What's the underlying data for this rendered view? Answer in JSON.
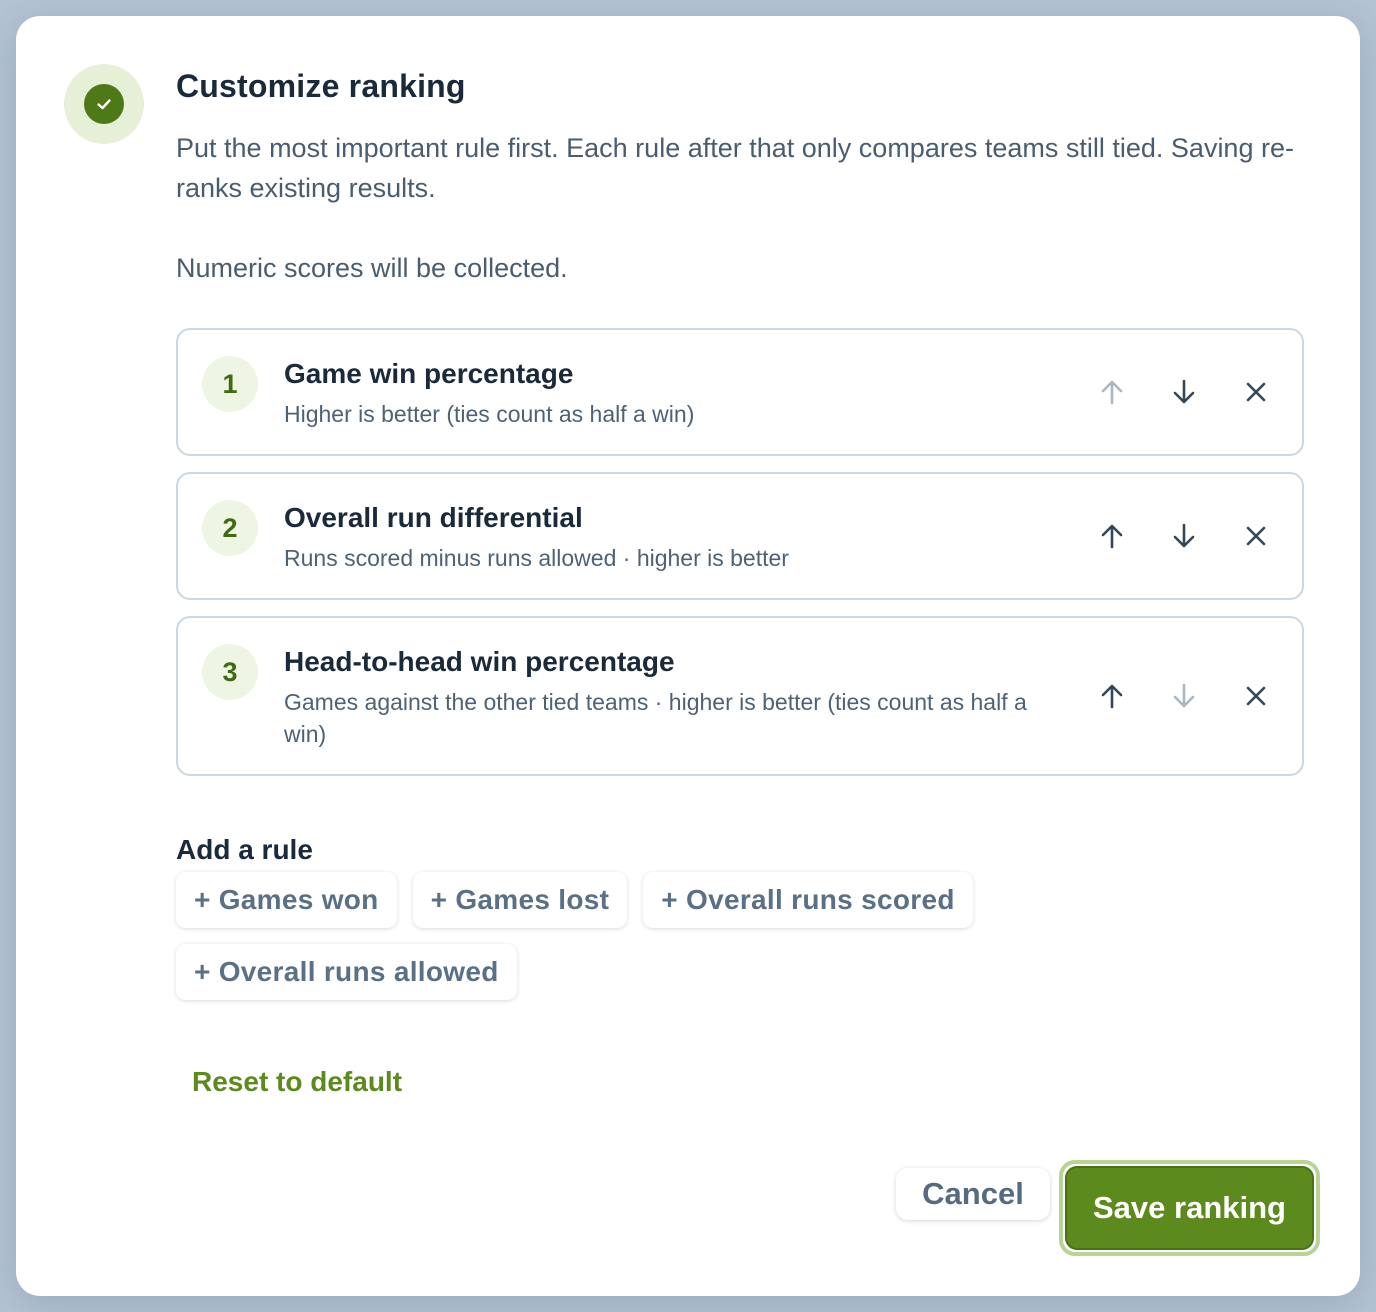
{
  "dialog": {
    "title": "Customize ranking",
    "description_1": "Put the most important rule first. Each rule after that only compares teams still tied. Saving re-ranks existing results.",
    "description_2": "Numeric scores will be collected."
  },
  "rules": [
    {
      "number": "1",
      "name": "Game win percentage",
      "detail": "Higher is better (ties count as half a win)",
      "move_up_enabled": false,
      "move_down_enabled": true
    },
    {
      "number": "2",
      "name": "Overall run differential",
      "detail": "Runs scored minus runs allowed · higher is better",
      "move_up_enabled": true,
      "move_down_enabled": true
    },
    {
      "number": "3",
      "name": "Head-to-head win percentage",
      "detail": "Games against the other tied teams · higher is better (ties count as half a win)",
      "move_up_enabled": true,
      "move_down_enabled": false
    }
  ],
  "add_rule": {
    "title": "Add a rule",
    "options": [
      "+ Games won",
      "+ Games lost",
      "+ Overall runs scored",
      "+ Overall runs allowed"
    ]
  },
  "reset_label": "Reset to default",
  "footer": {
    "cancel_label": "Cancel",
    "save_label": "Save ranking"
  },
  "icons": {
    "badge": "check-icon",
    "move_up": "arrow-up-icon",
    "move_down": "arrow-down-icon",
    "remove": "close-icon"
  },
  "colors": {
    "accent": "#5d8a1c",
    "accent_dark": "#4d7a16",
    "icon_enabled": "#33475b",
    "icon_disabled": "#a9b6c3"
  }
}
